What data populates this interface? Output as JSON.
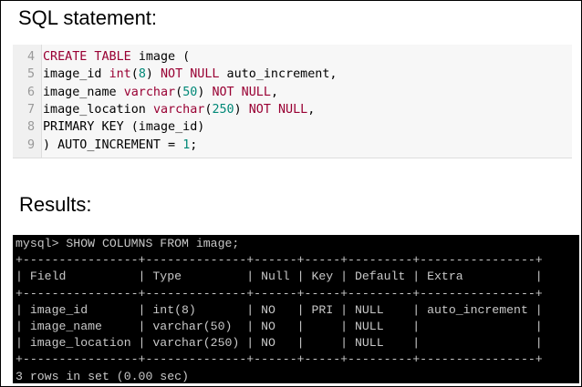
{
  "headings": {
    "sql": "SQL statement:",
    "results": "Results:"
  },
  "code": {
    "lines": [
      {
        "num": "4",
        "parts": [
          {
            "t": "CREATE TABLE ",
            "c": "kw"
          },
          {
            "t": "image (",
            "c": "plain"
          }
        ]
      },
      {
        "num": "5",
        "parts": [
          {
            "t": "image_id ",
            "c": "plain"
          },
          {
            "t": "int",
            "c": "tp"
          },
          {
            "t": "(",
            "c": "plain"
          },
          {
            "t": "8",
            "c": "num"
          },
          {
            "t": ") ",
            "c": "plain"
          },
          {
            "t": "NOT NULL",
            "c": "kw"
          },
          {
            "t": " auto_increment,",
            "c": "plain"
          }
        ]
      },
      {
        "num": "6",
        "parts": [
          {
            "t": "image_name ",
            "c": "plain"
          },
          {
            "t": "varchar",
            "c": "tp"
          },
          {
            "t": "(",
            "c": "plain"
          },
          {
            "t": "50",
            "c": "num"
          },
          {
            "t": ") ",
            "c": "plain"
          },
          {
            "t": "NOT NULL",
            "c": "kw"
          },
          {
            "t": ",",
            "c": "plain"
          }
        ]
      },
      {
        "num": "7",
        "parts": [
          {
            "t": "image_location ",
            "c": "plain"
          },
          {
            "t": "varchar",
            "c": "tp"
          },
          {
            "t": "(",
            "c": "plain"
          },
          {
            "t": "250",
            "c": "num"
          },
          {
            "t": ") ",
            "c": "plain"
          },
          {
            "t": "NOT NULL",
            "c": "kw"
          },
          {
            "t": ",",
            "c": "plain"
          }
        ]
      },
      {
        "num": "8",
        "parts": [
          {
            "t": "PRIMARY KEY (image_id)",
            "c": "plain"
          }
        ]
      },
      {
        "num": "9",
        "parts": [
          {
            "t": ") AUTO_INCREMENT = ",
            "c": "plain"
          },
          {
            "t": "1",
            "c": "num"
          },
          {
            "t": ";",
            "c": "plain"
          }
        ]
      }
    ]
  },
  "console": {
    "lines": [
      "mysql> SHOW COLUMNS FROM image;",
      "+----------------+--------------+------+-----+---------+----------------+",
      "| Field          | Type         | Null | Key | Default | Extra          |",
      "+----------------+--------------+------+-----+---------+----------------+",
      "| image_id       | int(8)       | NO   | PRI | NULL    | auto_increment |",
      "| image_name     | varchar(50)  | NO   |     | NULL    |                |",
      "| image_location | varchar(250) | NO   |     | NULL    |                |",
      "+----------------+--------------+------+-----+---------+----------------+",
      "3 rows in set (0.00 sec)"
    ]
  },
  "colors": {
    "keyword": "#990033",
    "number": "#008877",
    "console_bg": "#000000",
    "console_text": "#c8c8c8"
  }
}
